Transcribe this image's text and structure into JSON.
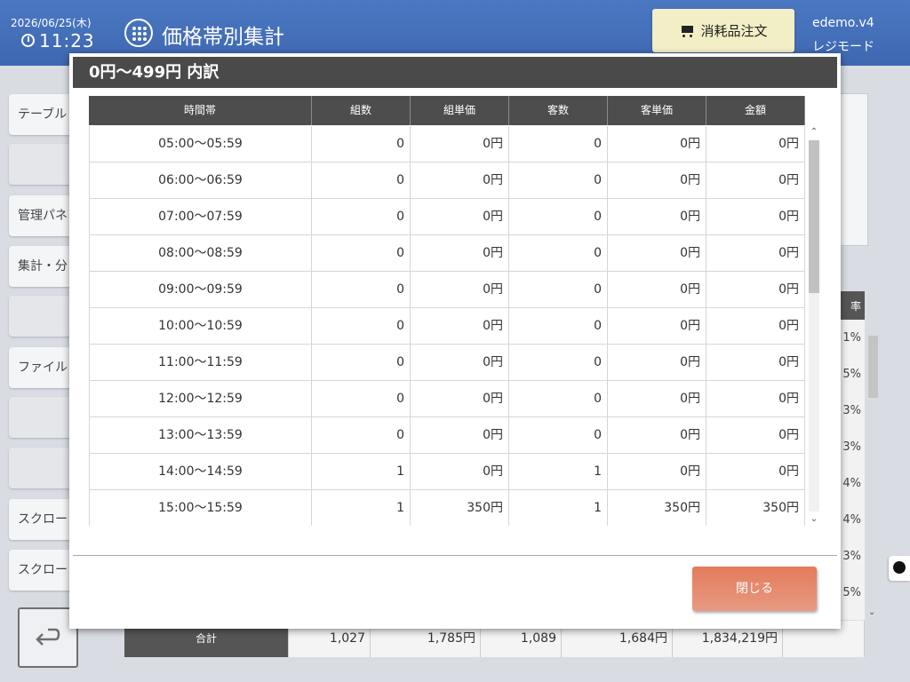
{
  "header": {
    "date": "2026/06/25(木)",
    "time": "11:23",
    "title": "価格帯別集計",
    "order_button": "消耗品注文",
    "user": "edemo.v4",
    "mode": "レジモード"
  },
  "sidebar": {
    "items": [
      {
        "label": "テーブル",
        "blank": false
      },
      {
        "label": "",
        "blank": true
      },
      {
        "label": "管理パネ",
        "blank": false
      },
      {
        "label": "集計・分",
        "blank": false
      },
      {
        "label": "",
        "blank": true
      },
      {
        "label": "ファイル",
        "blank": false
      },
      {
        "label": "",
        "blank": true
      },
      {
        "label": "",
        "blank": true
      },
      {
        "label": "スクロー",
        "blank": false
      },
      {
        "label": "スクロー",
        "blank": false
      }
    ]
  },
  "background": {
    "pct_col_header": "率",
    "percents": [
      "1%",
      "5%",
      "3%",
      "3%",
      "4%",
      "4%",
      "3%",
      "5%"
    ],
    "totals": [
      "合計",
      "1,027",
      "1,785円",
      "1,089",
      "1,684円",
      "1,834,219円",
      ""
    ]
  },
  "modal": {
    "title": "0円～499円 内訳",
    "columns": [
      "時間帯",
      "組数",
      "組単価",
      "客数",
      "客単価",
      "金額"
    ],
    "rows": [
      [
        "05:00～05:59",
        "0",
        "0円",
        "0",
        "0円",
        "0円"
      ],
      [
        "06:00～06:59",
        "0",
        "0円",
        "0",
        "0円",
        "0円"
      ],
      [
        "07:00～07:59",
        "0",
        "0円",
        "0",
        "0円",
        "0円"
      ],
      [
        "08:00～08:59",
        "0",
        "0円",
        "0",
        "0円",
        "0円"
      ],
      [
        "09:00～09:59",
        "0",
        "0円",
        "0",
        "0円",
        "0円"
      ],
      [
        "10:00～10:59",
        "0",
        "0円",
        "0",
        "0円",
        "0円"
      ],
      [
        "11:00～11:59",
        "0",
        "0円",
        "0",
        "0円",
        "0円"
      ],
      [
        "12:00～12:59",
        "0",
        "0円",
        "0",
        "0円",
        "0円"
      ],
      [
        "13:00～13:59",
        "0",
        "0円",
        "0",
        "0円",
        "0円"
      ],
      [
        "14:00～14:59",
        "1",
        "0円",
        "1",
        "0円",
        "0円"
      ],
      [
        "15:00～15:59",
        "1",
        "350円",
        "1",
        "350円",
        "350円"
      ]
    ],
    "close_button": "閉じる"
  }
}
